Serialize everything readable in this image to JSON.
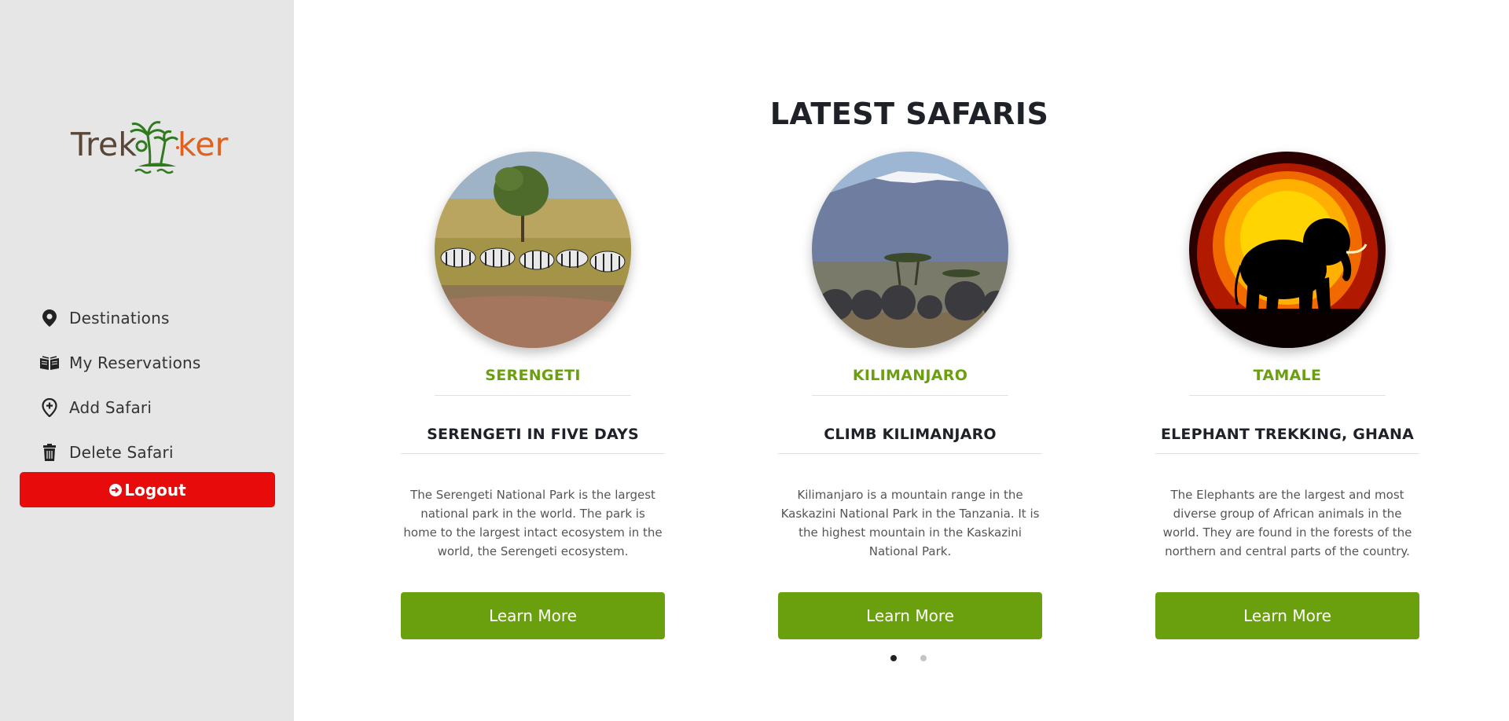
{
  "brand": {
    "word_left": "Trek",
    "word_right": "ker",
    "color_left": "#5a4636",
    "color_right": "#e2601c"
  },
  "sidebar": {
    "items": [
      {
        "label": "Destinations",
        "icon": "location-pin-icon"
      },
      {
        "label": "My Reservations",
        "icon": "book-open-icon"
      },
      {
        "label": "Add Safari",
        "icon": "add-location-icon"
      },
      {
        "label": "Delete Safari",
        "icon": "trash-icon"
      }
    ],
    "logout_label": "Logout",
    "logout_color": "#e80b0b"
  },
  "main": {
    "heading": "LATEST SAFARIS",
    "accent_color": "#6aa00d",
    "cards": [
      {
        "location": "SERENGETI",
        "title": "SERENGETI IN FIVE DAYS",
        "description": "The Serengeti National Park is the largest national park in the world. The park is home to the largest intact ecosystem in the world, the Serengeti ecosystem.",
        "button": "Learn More",
        "image": "zebras-savanna-photo"
      },
      {
        "location": "KILIMANJARO",
        "title": "CLIMB KILIMANJARO",
        "description": "Kilimanjaro is a mountain range in the Kaskazini National Park in the Tanzania. It is the highest mountain in the Kaskazini National Park.",
        "button": "Learn More",
        "image": "elephants-kilimanjaro-photo"
      },
      {
        "location": "TAMALE",
        "title": "ELEPHANT TREKKING, GHANA",
        "description": "The Elephants are the largest and most diverse group of African animals in the world. They are found in the forests of the northern and central parts of the country.",
        "button": "Learn More",
        "image": "elephant-sunset-silhouette-photo"
      }
    ],
    "carousel": {
      "pages": 2,
      "active": 1
    }
  }
}
